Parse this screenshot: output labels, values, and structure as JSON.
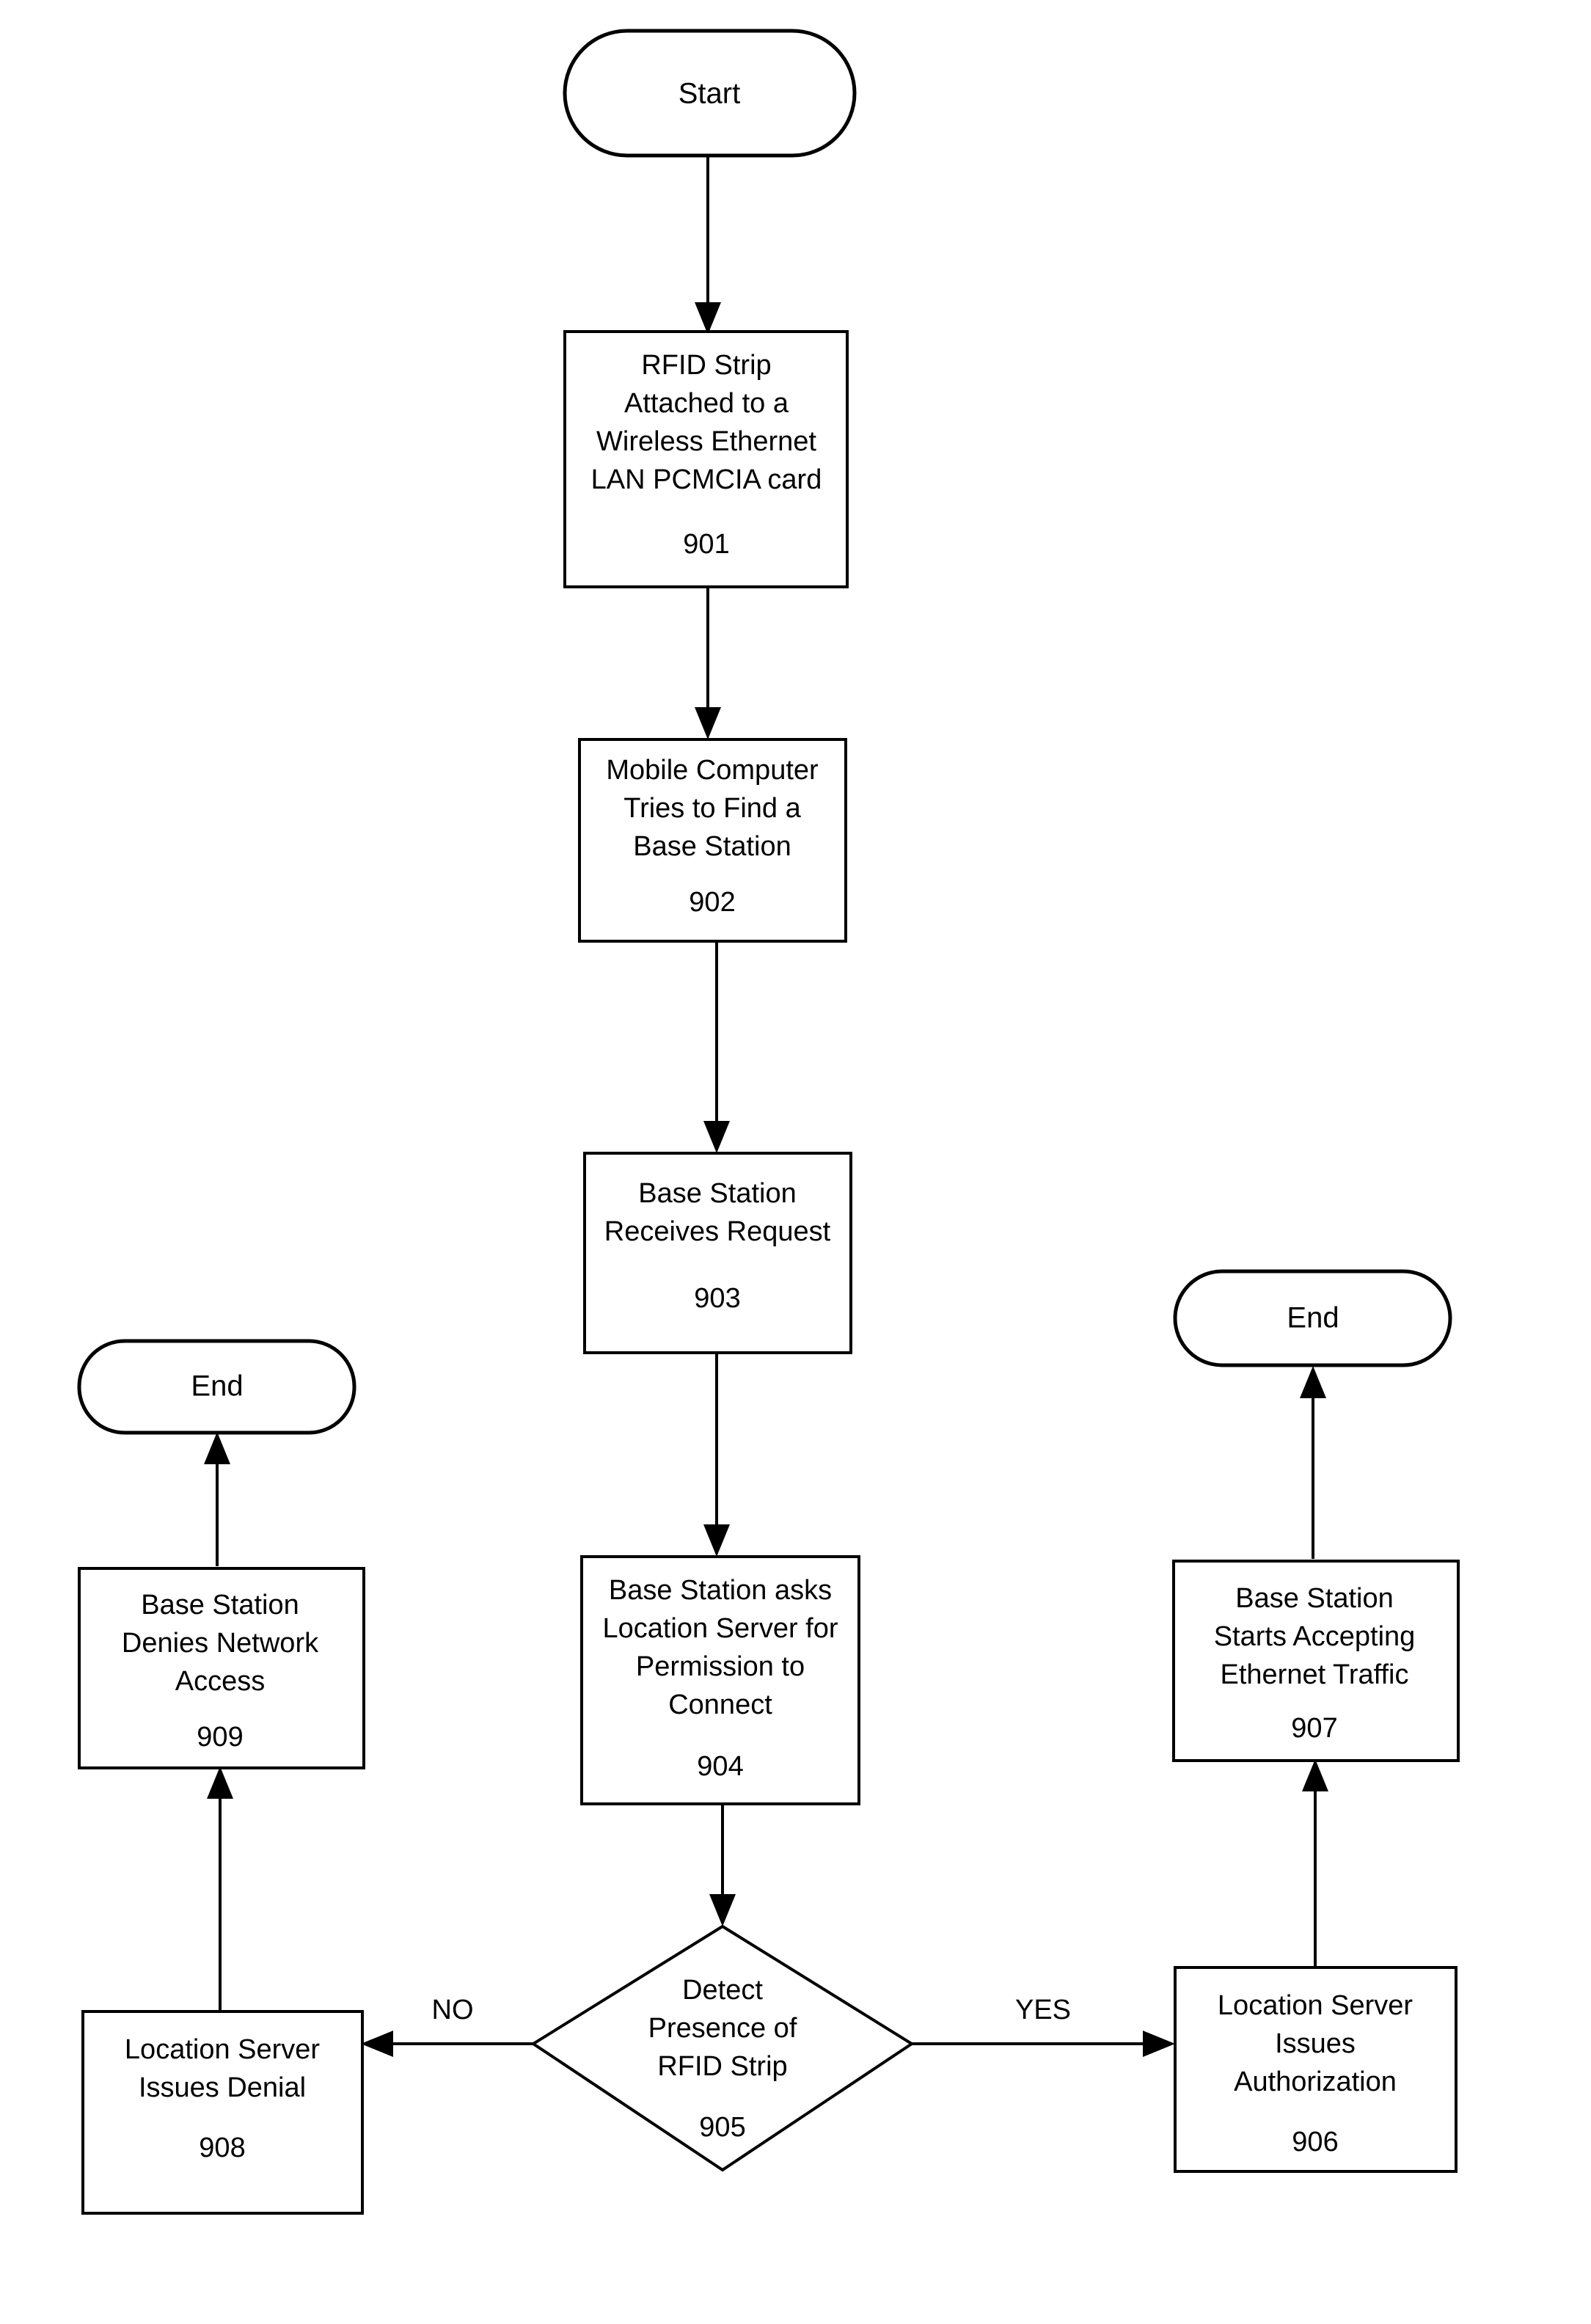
{
  "diagram": {
    "type": "flowchart",
    "orientation": "top-to-bottom",
    "background_color": "#ffffff",
    "line_color": "#000000",
    "nodes": {
      "start": {
        "shape": "terminator",
        "label": "Start"
      },
      "n901": {
        "shape": "process",
        "line1": "RFID Strip",
        "line2": "Attached to a",
        "line3": "Wireless Ethernet",
        "line4": "LAN PCMCIA card",
        "ref": "901"
      },
      "n902": {
        "shape": "process",
        "line1": "Mobile Computer",
        "line2": "Tries to Find a",
        "line3": "Base Station",
        "ref": "902"
      },
      "n903": {
        "shape": "process",
        "line1": "Base Station",
        "line2": "Receives Request",
        "ref": "903"
      },
      "n904": {
        "shape": "process",
        "line1": "Base Station asks",
        "line2": "Location Server for",
        "line3": "Permission to",
        "line4": "Connect",
        "ref": "904"
      },
      "n905": {
        "shape": "decision",
        "line1": "Detect",
        "line2": "Presence of",
        "line3": "RFID Strip",
        "ref": "905"
      },
      "n906": {
        "shape": "process",
        "line1": "Location Server",
        "line2": "Issues",
        "line3": "Authorization",
        "ref": "906"
      },
      "n907": {
        "shape": "process",
        "line1": "Base Station",
        "line2": "Starts Accepting",
        "line3": "Ethernet Traffic",
        "ref": "907"
      },
      "n908": {
        "shape": "process",
        "line1": "Location Server",
        "line2": "Issues Denial",
        "ref": "908"
      },
      "n909": {
        "shape": "process",
        "line1": "Base Station",
        "line2": "Denies Network",
        "line3": "Access",
        "ref": "909"
      },
      "end_left": {
        "shape": "terminator",
        "label": "End"
      },
      "end_right": {
        "shape": "terminator",
        "label": "End"
      }
    },
    "edge_labels": {
      "no_branch": "NO",
      "yes_branch": "YES"
    }
  }
}
